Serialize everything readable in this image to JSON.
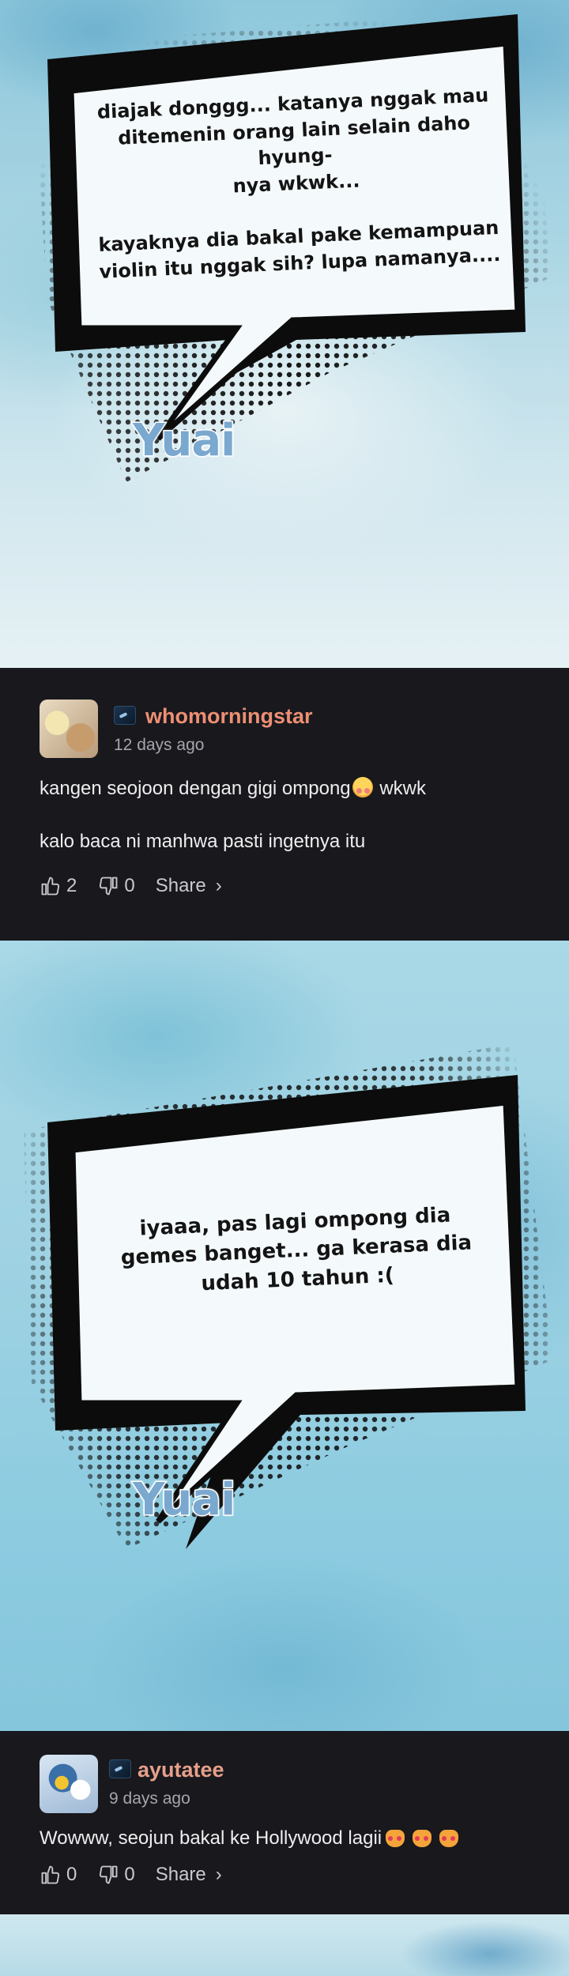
{
  "panels": [
    {
      "speech": "diajak donggg... katanya nggak mau\nditemenin orang lain selain daho hyung-\nnya wkwk...\n\nkayaknya dia bakal pake kemampuan\nviolin itu nggak sih? lupa namanya....",
      "speaker": "Yuai"
    },
    {
      "speech": "iyaaa, pas lagi ompong dia\ngemes banget... ga kerasa dia\nudah 10 tahun :(",
      "speaker": "Yuai"
    }
  ],
  "comments": [
    {
      "username": "whomorningstar",
      "time": "12 days ago",
      "line1": "kangen seojoon dengan gigi ompong",
      "line1_suffix": "wkwk",
      "line2": "kalo baca ni manhwa pasti ingetnya itu",
      "likes": "2",
      "dislikes": "0",
      "share": "Share",
      "share_chevron": "›"
    },
    {
      "username": "ayutatee",
      "time": "9 days ago",
      "line1": "Wowww, seojun bakal ke Hollywood lagii",
      "likes": "0",
      "dislikes": "0",
      "share": "Share",
      "share_chevron": "›"
    }
  ],
  "colors": {
    "comment_bg": "#18181d",
    "username": "#ec8f73",
    "speaker_name": "#7aa8cf"
  },
  "icons": [
    "thumbs-up-icon",
    "thumbs-down-icon",
    "chevron-right-icon",
    "badge-icon",
    "sad-face-emoji",
    "cat-face-emoji"
  ]
}
